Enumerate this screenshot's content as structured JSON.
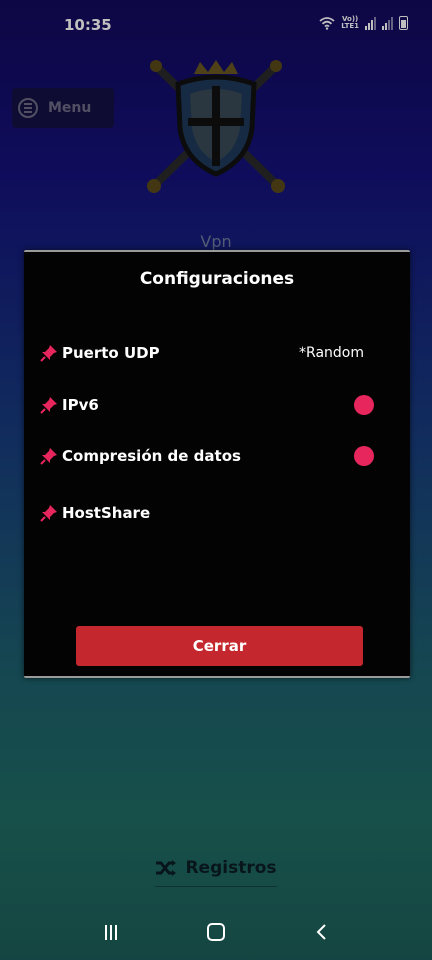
{
  "status_bar": {
    "time": "10:35",
    "volte_line1": "Vo))",
    "volte_line2": "LTE1"
  },
  "background": {
    "menu_label": "Menu",
    "app_title": "Vpn",
    "registros_label": "Registros"
  },
  "dialog": {
    "title": "Configuraciones",
    "rows": [
      {
        "label": "Puerto UDP",
        "value": "*Random"
      },
      {
        "label": "IPv6",
        "toggle_on": true
      },
      {
        "label": "Compresión de datos",
        "toggle_on": true
      },
      {
        "label": "HostShare"
      }
    ],
    "close_label": "Cerrar"
  },
  "colors": {
    "toggle": "#e8265e",
    "close_button": "#c4272d",
    "pin": "#e8265e"
  },
  "icons": {
    "pin": "pushpin-icon",
    "shuffle": "shuffle-icon",
    "menu": "menu-icon"
  }
}
